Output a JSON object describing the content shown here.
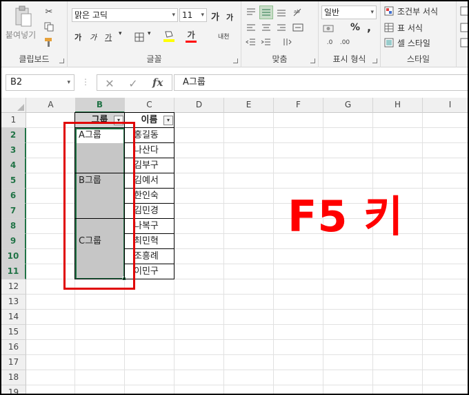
{
  "ribbon": {
    "clipboard": {
      "paste_label": "붙여넣기",
      "group_label": "클립보드"
    },
    "font": {
      "font_name": "맑은 고딕",
      "font_size": "11",
      "group_label": "글꼴",
      "grow_label": "가",
      "shrink_label": "가",
      "bold": "가",
      "italic": "가",
      "underline": "가",
      "font_color_label": "가",
      "phonetic_label": "내천"
    },
    "align": {
      "group_label": "맞춤"
    },
    "number": {
      "format": "일반",
      "percent": "%",
      "comma": ",",
      "group_label": "표시 형식"
    },
    "style": {
      "conditional": "조건부 서식",
      "table_format": "표 서식",
      "cell_style": "셀 스타일",
      "group_label": "스타일"
    }
  },
  "formula_bar": {
    "name_box": "B2",
    "fx": "fx",
    "content": "A그룹"
  },
  "grid": {
    "columns": [
      "A",
      "B",
      "C",
      "D",
      "E",
      "F",
      "G",
      "H",
      "I"
    ],
    "rows": [
      "1",
      "2",
      "3",
      "4",
      "5",
      "6",
      "7",
      "8",
      "9",
      "10",
      "11",
      "12",
      "13",
      "14",
      "15",
      "16",
      "17",
      "18",
      "19"
    ],
    "header_b": "그룹",
    "header_c": "이름",
    "group_cells": [
      "A그룹",
      "B그룹",
      "C그룹"
    ],
    "names": [
      "홍길동",
      "나산다",
      "김부구",
      "김예서",
      "한인숙",
      "김민경",
      "나복구",
      "최민혁",
      "조흥례",
      "이민구"
    ]
  },
  "annotation": {
    "text": "F5 키",
    "color": "#ff0000"
  },
  "colors": {
    "accent": "#217346",
    "selection": "#c6c6c6",
    "highlight_box": "#e00000"
  }
}
